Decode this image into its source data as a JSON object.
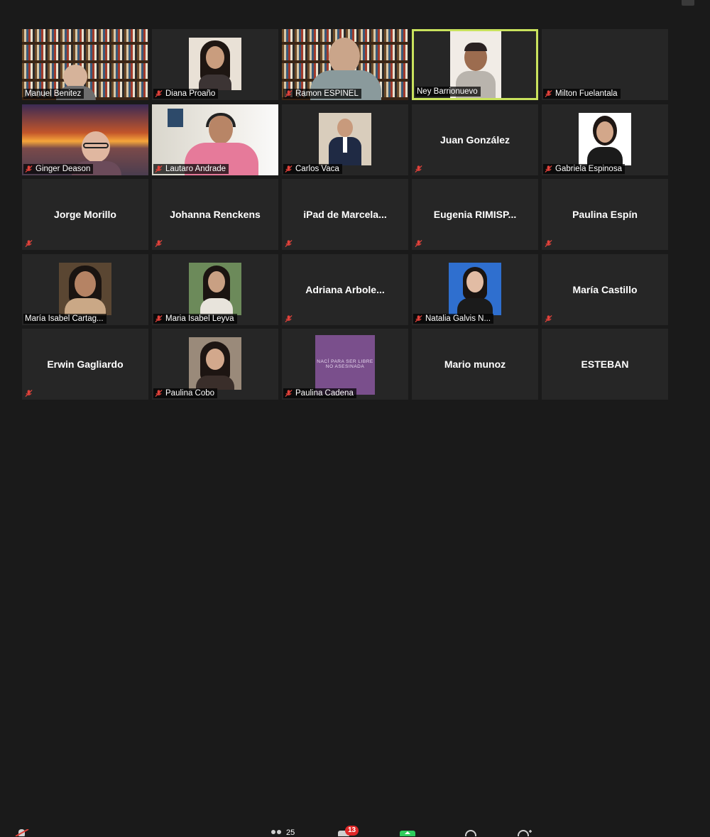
{
  "participants": [
    {
      "name": "Manuel Benitez",
      "display": "video",
      "muted": false
    },
    {
      "name": "Diana Proaño",
      "display": "video",
      "muted": true
    },
    {
      "name": "Ramon ESPINEL",
      "display": "video",
      "muted": true
    },
    {
      "name": "Ney Barrionuevo",
      "display": "video",
      "muted": false,
      "active_speaker": true
    },
    {
      "name": "Milton Fuelantala",
      "display": "name",
      "muted": true
    },
    {
      "name": "Ginger Deason",
      "display": "video",
      "muted": true
    },
    {
      "name": "Lautaro Andrade",
      "display": "video",
      "muted": true
    },
    {
      "name": "Carlos Vaca",
      "display": "video",
      "muted": true
    },
    {
      "name": "Juan González",
      "display": "name",
      "muted": true
    },
    {
      "name": "Gabriela Espinosa",
      "display": "video",
      "muted": true
    },
    {
      "name": "Jorge Morillo",
      "display": "name",
      "muted": true
    },
    {
      "name": "Johanna Renckens",
      "display": "name",
      "muted": true
    },
    {
      "name": "iPad  de  Marcela...",
      "display": "name",
      "muted": true
    },
    {
      "name": "Eugenia  RIMISP...",
      "display": "name",
      "muted": true
    },
    {
      "name": "Paulina Espín",
      "display": "name",
      "muted": true
    },
    {
      "name": "María Isabel Cartag...",
      "display": "video",
      "muted": false
    },
    {
      "name": "Maria Isabel Leyva",
      "display": "video",
      "muted": true
    },
    {
      "name": "Adriana  Arbole...",
      "display": "name",
      "muted": true
    },
    {
      "name": "Natalia Galvis N...",
      "display": "video",
      "muted": true
    },
    {
      "name": "María Castillo",
      "display": "name",
      "muted": true
    },
    {
      "name": "Erwin Gagliardo",
      "display": "name",
      "muted": true
    },
    {
      "name": "Paulina Cobo",
      "display": "video",
      "muted": true
    },
    {
      "name": "Paulina Cadena",
      "display": "video",
      "muted": true,
      "image_text": [
        "NACÍ PARA SER LIBRE",
        "NO ASESINADA"
      ]
    },
    {
      "name": "Mario munoz",
      "display": "name",
      "muted": false
    },
    {
      "name": "ESTEBAN",
      "display": "name",
      "muted": false
    }
  ],
  "toolbar": {
    "participants_count": "25",
    "chat_badge": "13",
    "icons": [
      "mic-muted-icon",
      "participants-icon",
      "chat-icon",
      "share-screen-icon",
      "record-icon",
      "reactions-icon"
    ]
  },
  "colors": {
    "background": "#1a1a1a",
    "tile": "#262626",
    "active_border": "#c9e25d",
    "mute_red": "#e0413a"
  }
}
